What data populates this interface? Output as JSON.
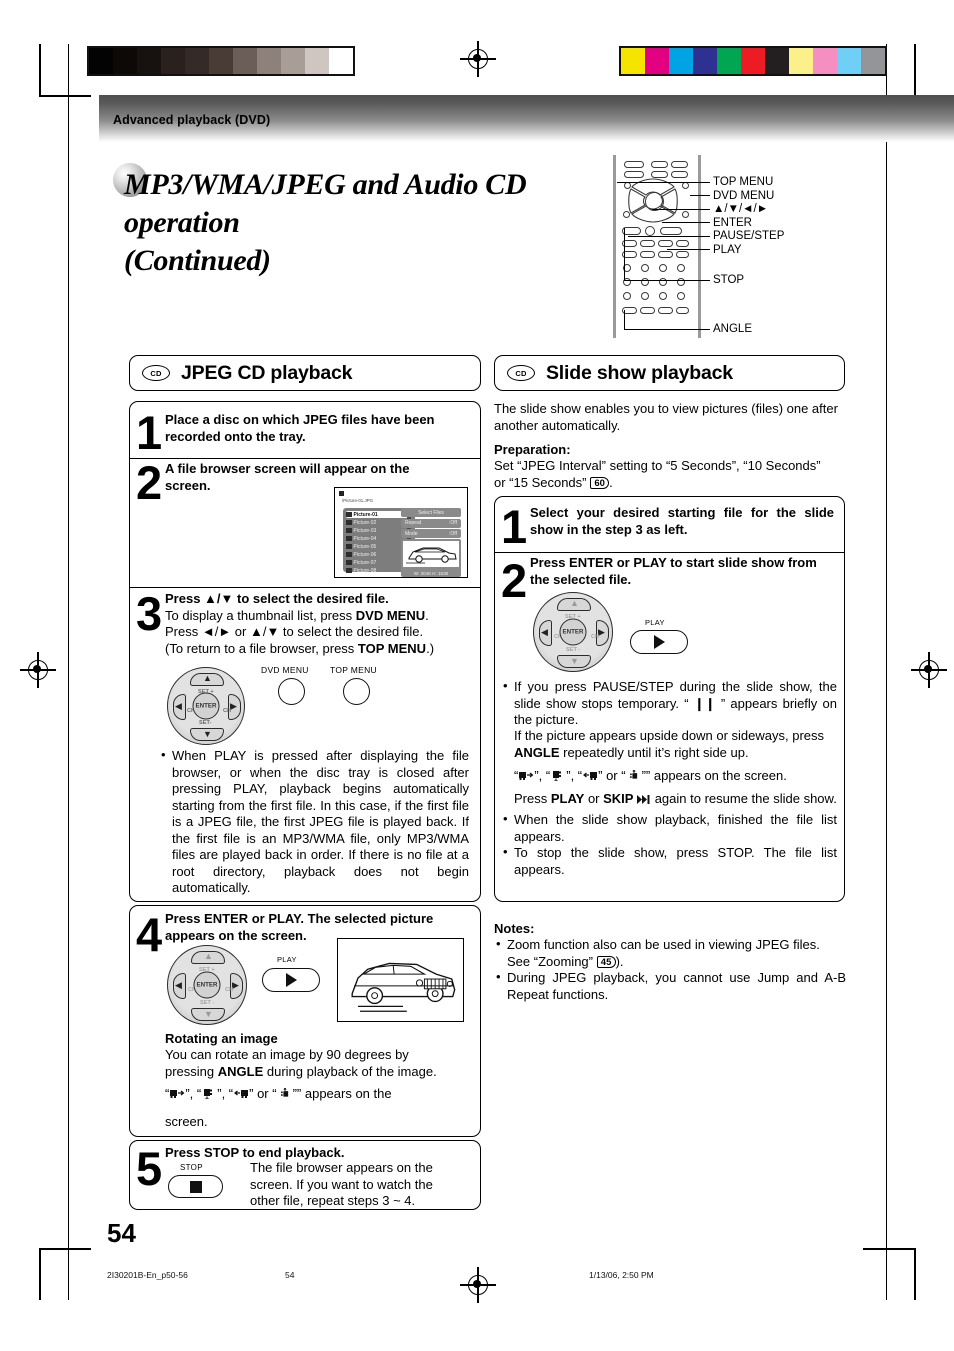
{
  "meta": {
    "page_number": "54",
    "footer_file": "2I30201B-En_p50-56",
    "footer_page": "54",
    "footer_date": "1/13/06, 2:50 PM"
  },
  "banner": {
    "title": "Advanced playback (DVD)"
  },
  "heading": {
    "line1": "MP3/WMA/JPEG and Audio CD operation",
    "line2": "(Continued)"
  },
  "remote": {
    "callouts": [
      "TOP MENU",
      "DVD MENU",
      "▲/▼/◄/►",
      "ENTER",
      "PAUSE/STEP",
      "PLAY",
      "STOP",
      "ANGLE"
    ]
  },
  "left": {
    "header": {
      "disc_icon_label": "CD",
      "title": "JPEG CD playback"
    },
    "steps": [
      {
        "num": "1",
        "text": "Place a disc on which JPEG files have been recorded onto the tray."
      },
      {
        "num": "2",
        "text": "A file browser screen will appear on the screen."
      },
      {
        "num": "3",
        "bold": "Press ▲/▼ to select the desired file.",
        "l1a": "To display a thumbnail list, press ",
        "l1b": "DVD MENU",
        "l1c": ".",
        "l2": "Press ◄/► or ▲/▼ to select the desired file.",
        "l3a": "(To return to a file browser, press ",
        "l3b": "TOP MENU",
        "l3c": ".)",
        "key_dvd_menu": "DVD MENU",
        "key_top_menu": "TOP MENU",
        "bullet": "When PLAY is pressed after displaying the file browser, or when the disc tray is closed after pressing PLAY, playback begins automatically starting from the first file. In this case, if the first file is a JPEG file, the first JPEG file is played back. If the first file is an MP3/WMA file, only MP3/WMA files are played back in order. If there is no file at a root directory, playback does not begin automatically."
      },
      {
        "num": "4",
        "text": "Press ENTER or PLAY. The selected picture appears on the screen.",
        "sub_title": "Rotating an image",
        "sub_line1": "You can rotate an image by 90 degrees by",
        "sub_line2a": "pressing ",
        "sub_line2b": "ANGLE",
        "sub_line2c": " during playback of the image.",
        "sub_line3_tail": "” appears on the",
        "sub_line4": "screen.",
        "play_label": "PLAY"
      },
      {
        "num": "5",
        "bold": "Press STOP to end playback.",
        "body": "The file browser appears on the screen. If you want to watch the other file, repeat steps 3 ~ 4.",
        "stop_label": "STOP"
      }
    ],
    "osd": {
      "title": "/Picture-01.JPG",
      "files": [
        "Picture-01",
        "Picture-02",
        "Picture-03",
        "Picture-04",
        "Picture-05",
        "Picture-06",
        "Picture-07",
        "Picture-08"
      ],
      "select_files": "Select Files",
      "repeat_label": "Repeat",
      "repeat_value": ":Off",
      "mode_label": "Mode",
      "mode_value": ":Off",
      "thumb_caption": "W: 2048  H: 1536"
    }
  },
  "right": {
    "header": {
      "disc_icon_label": "CD",
      "title": "Slide show playback"
    },
    "intro": "The slide show enables you to view pictures (files) one after another automatically.",
    "prep_label": "Preparation:",
    "prep_line1": "Set “JPEG Interval” setting to “5 Seconds”, “10 Seconds”",
    "prep_line2a": "or “15 Seconds” ",
    "prep_ref": "60",
    "prep_line2b": ".",
    "steps": [
      {
        "num": "1",
        "text": "Select your desired starting file for the slide show in the step 3 as left."
      },
      {
        "num": "2",
        "text": "Press ENTER or PLAY to start slide show from the selected file.",
        "play_label": "PLAY",
        "bullets": [
          "If you press PAUSE/STEP during the slide show, the slide show stops temporary. “ ❙❙ ” appears briefly on the picture.",
          "When the slide show playback, finished the file list appears.",
          "To stop the slide show, press STOP. The file list appears."
        ],
        "cont_line1": "If the picture appears upside down or sideways, press",
        "cont_line2a": "ANGLE",
        "cont_line2b": " repeatedly until it’s right side up.",
        "glyph_tail": "” appears on the screen.",
        "resume_a": "Press ",
        "resume_b": "PLAY",
        "resume_c": " or ",
        "resume_d": "SKIP",
        "resume_e": " again to resume the slide show."
      }
    ],
    "notes_label": "Notes:",
    "notes": [
      {
        "a": "Zoom function also can be used in viewing JPEG files.",
        "b": "See “Zooming” ",
        "ref": "45",
        "c": ")."
      },
      {
        "a": "During JPEG playback, you cannot use Jump and A-B Repeat functions."
      }
    ]
  },
  "colorbars": {
    "gray": [
      "#030303",
      "#0d0907",
      "#17110f",
      "#2a211d",
      "#352b26",
      "#493c35",
      "#6b5d57",
      "#8e807a",
      "#a99d98",
      "#cfc6c2",
      "#ffffff"
    ],
    "color": [
      "#f5e400",
      "#e20080",
      "#00a4e4",
      "#2e3192",
      "#00a651",
      "#ed1c24",
      "#231f20",
      "#fbf08a",
      "#f58fc2",
      "#6fcff6",
      "#939598"
    ]
  }
}
